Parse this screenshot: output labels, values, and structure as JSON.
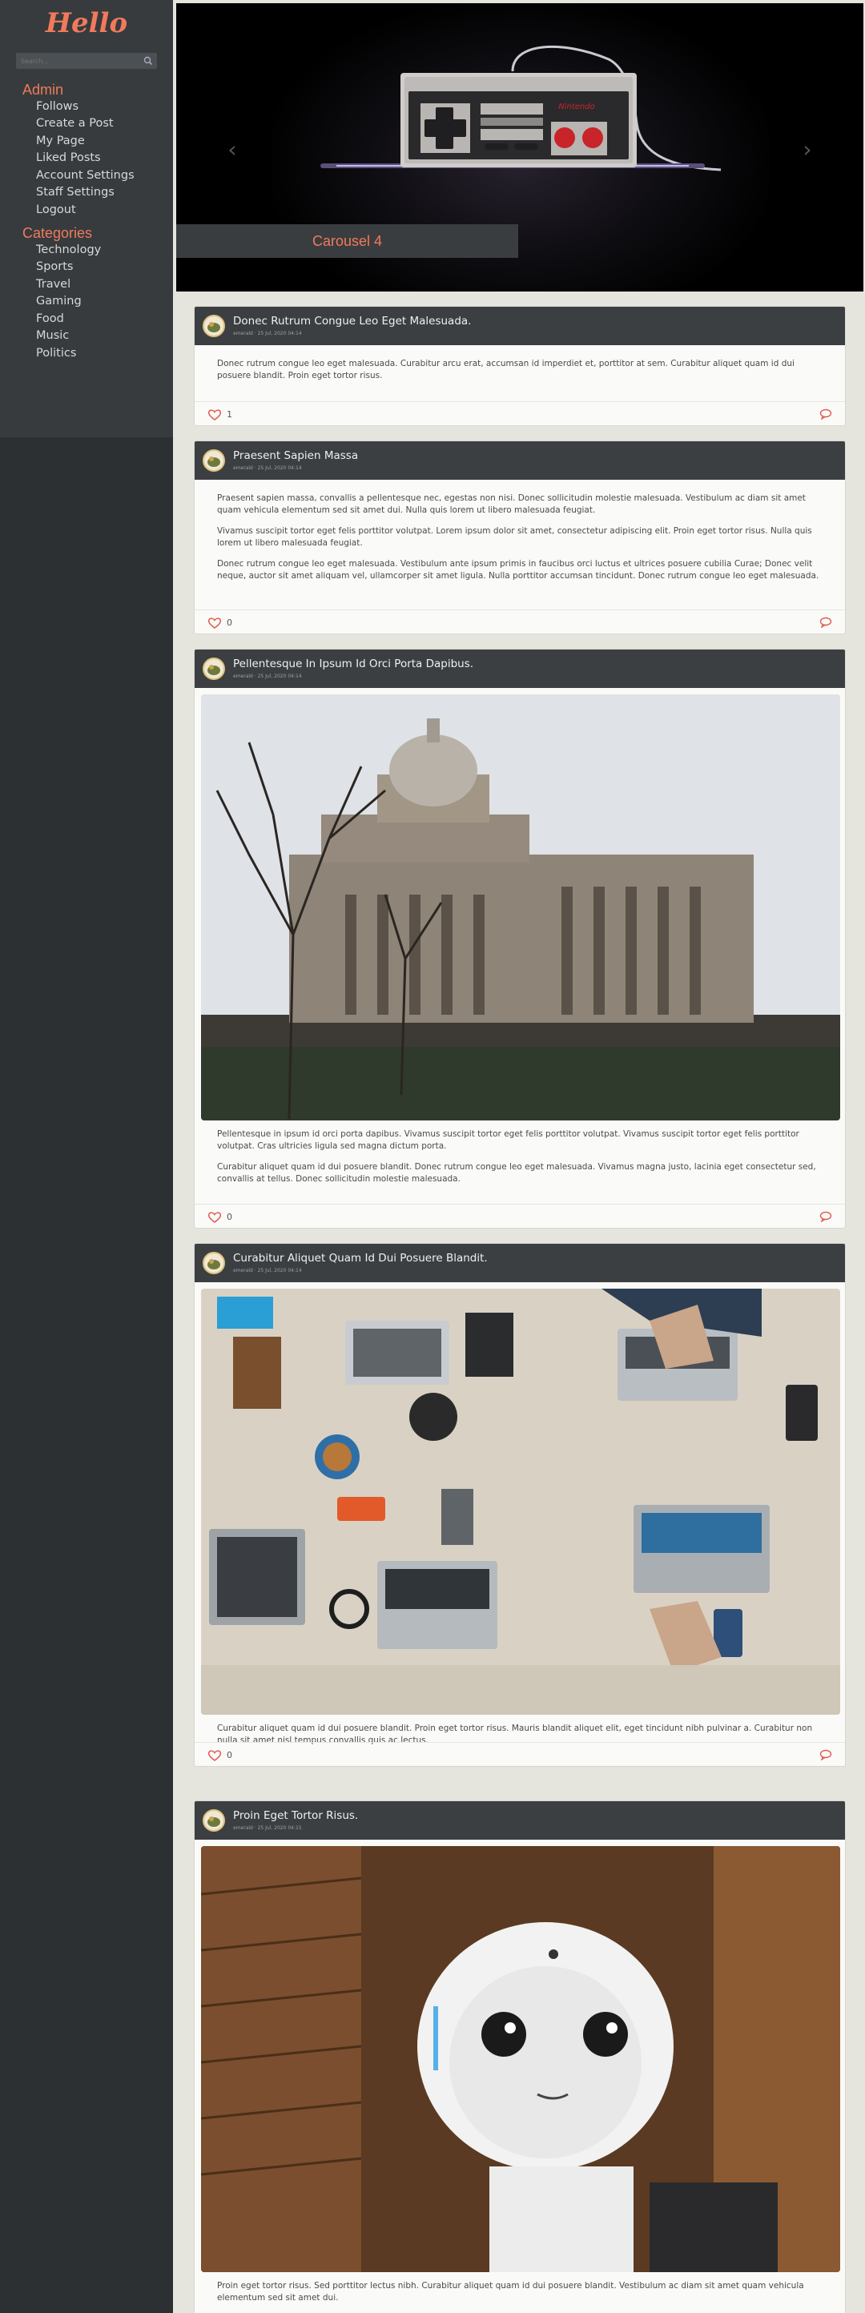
{
  "logo": "Hello",
  "search": {
    "placeholder": "Search..."
  },
  "sidebar": {
    "admin_heading": "Admin",
    "admin_items": [
      "Follows",
      "Create a Post",
      "My Page",
      "Liked Posts",
      "Account Settings",
      "Staff Settings",
      "Logout"
    ],
    "categories_heading": "Categories",
    "category_items": [
      "Technology",
      "Sports",
      "Travel",
      "Gaming",
      "Food",
      "Music",
      "Politics"
    ]
  },
  "carousel": {
    "caption": "Carousel 4",
    "image_text": "Nintendo"
  },
  "posts": [
    {
      "title": "Donec Rutrum Congue Leo Eget Malesuada.",
      "meta": "emerald · 25 Jul, 2020 04:14",
      "paragraphs": [
        "Donec rutrum congue leo eget malesuada. Curabitur arcu erat, accumsan id imperdiet et, porttitor at sem. Curabitur aliquet quam id dui posuere blandit. Proin eget tortor risus."
      ],
      "likes": "1"
    },
    {
      "title": "Praesent Sapien Massa",
      "meta": "emerald · 25 Jul, 2020 04:14",
      "paragraphs": [
        "Praesent sapien massa, convallis a pellentesque nec, egestas non nisi. Donec sollicitudin molestie malesuada. Vestibulum ac diam sit amet quam vehicula elementum sed sit amet dui. Nulla quis lorem ut libero malesuada feugiat.",
        "Vivamus suscipit tortor eget felis porttitor volutpat. Lorem ipsum dolor sit amet, consectetur adipiscing elit. Proin eget tortor risus. Nulla quis lorem ut libero malesuada feugiat.",
        "Donec rutrum congue leo eget malesuada. Vestibulum ante ipsum primis in faucibus orci luctus et ultrices posuere cubilia Curae; Donec velit neque, auctor sit amet aliquam vel, ullamcorper sit amet ligula. Nulla porttitor accumsan tincidunt. Donec rutrum congue leo eget malesuada."
      ],
      "likes": "0"
    },
    {
      "title": "Pellentesque In Ipsum Id Orci Porta Dapibus.",
      "meta": "emerald · 25 Jul, 2020 04:14",
      "paragraphs": [
        "Pellentesque in ipsum id orci porta dapibus. Vivamus suscipit tortor eget felis porttitor volutpat. Vivamus suscipit tortor eget felis porttitor volutpat. Cras ultricies ligula sed magna dictum porta.",
        "Curabitur aliquet quam id dui posuere blandit. Donec rutrum congue leo eget malesuada. Vivamus magna justo, lacinia eget consectetur sed, convallis at tellus. Donec sollicitudin molestie malesuada."
      ],
      "likes": "0"
    },
    {
      "title": "Curabitur Aliquet Quam Id Dui Posuere Blandit.",
      "meta": "emerald · 25 Jul, 2020 04:14",
      "paragraphs": [
        "Curabitur aliquet quam id dui posuere blandit. Proin eget tortor risus. Mauris blandit aliquet elit, eget tincidunt nibh pulvinar a. Curabitur non nulla sit amet nisl tempus convallis quis ac lectus."
      ],
      "likes": "0"
    },
    {
      "title": "Proin Eget Tortor Risus.",
      "meta": "emerald · 25 Jul, 2020 04:15",
      "paragraphs": [
        "Proin eget tortor risus. Sed porttitor lectus nibh. Curabitur aliquet quam id dui posuere blandit. Vestibulum ac diam sit amet quam vehicula elementum sed sit amet dui."
      ],
      "likes": ""
    }
  ],
  "colors": {
    "accent": "#f07a5b",
    "sidebar": "#2c3033",
    "header": "#3b3f42",
    "background": "#e6e5dd"
  },
  "icons": {
    "like": "heart-outline-icon",
    "comment": "speech-bubble-icon",
    "search": "magnifier-icon"
  }
}
